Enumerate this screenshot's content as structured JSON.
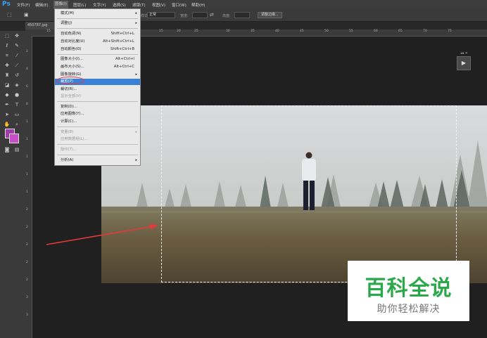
{
  "app": {
    "logo": "Ps"
  },
  "menubar": {
    "items": [
      "文件(F)",
      "编辑(E)",
      "图像(I)",
      "图层(L)",
      "文字(Y)",
      "选择(S)",
      "滤镜(T)",
      "视图(V)",
      "窗口(W)",
      "帮助(H)"
    ]
  },
  "options_bar": {
    "style_label": "样式:",
    "style_value": "正常",
    "width_label": "宽度:",
    "height_label": "高度:",
    "refine_edge_button": "调整边缘..."
  },
  "document": {
    "tab_title": "450787.jpg"
  },
  "rulers": {
    "top": [
      "15",
      "10",
      "15",
      "20",
      "25",
      "30",
      "35",
      "40",
      "45",
      "50",
      "55",
      "60",
      "65",
      "70",
      "75"
    ],
    "left": [
      "2",
      "4",
      "6",
      "8",
      "1",
      "1",
      "1",
      "1",
      "1",
      "2",
      "2",
      "2",
      "2",
      "2",
      "3",
      "3"
    ]
  },
  "image_menu": {
    "items": [
      {
        "label": "模式(M)",
        "submenu": true
      },
      {
        "label": "调整(J)",
        "submenu": true
      },
      {
        "label": "自动色调(N)",
        "shortcut": "Shift+Ctrl+L"
      },
      {
        "label": "自动对比度(U)",
        "shortcut": "Alt+Shift+Ctrl+L"
      },
      {
        "label": "自动颜色(O)",
        "shortcut": "Shift+Ctrl+B"
      },
      {
        "label": "图像大小(I)...",
        "shortcut": "Alt+Ctrl+I"
      },
      {
        "label": "画布大小(S)...",
        "shortcut": "Alt+Ctrl+C"
      },
      {
        "label": "图像旋转(G)",
        "submenu": true
      },
      {
        "label": "裁剪(P)",
        "highlighted": true
      },
      {
        "label": "裁切(R)..."
      },
      {
        "label": "显示全部(V)",
        "disabled": true
      },
      {
        "label": "复制(D)..."
      },
      {
        "label": "应用图像(Y)..."
      },
      {
        "label": "计算(C)..."
      },
      {
        "label": "变量(B)",
        "submenu": true,
        "disabled": true
      },
      {
        "label": "应用数据组(L)...",
        "disabled": true
      },
      {
        "label": "陷印(T)...",
        "disabled": true
      },
      {
        "label": "分析(A)",
        "submenu": true
      }
    ]
  },
  "swatches": {
    "foreground": "#a03ca8",
    "background": "#c84ec8"
  },
  "watermark": {
    "title": "百科全说",
    "subtitle": "助你轻松解决"
  },
  "colors": {
    "accent_highlight": "#3a80d6",
    "annotation_red": "#e53a4c",
    "brand_green": "#2aa84a"
  }
}
